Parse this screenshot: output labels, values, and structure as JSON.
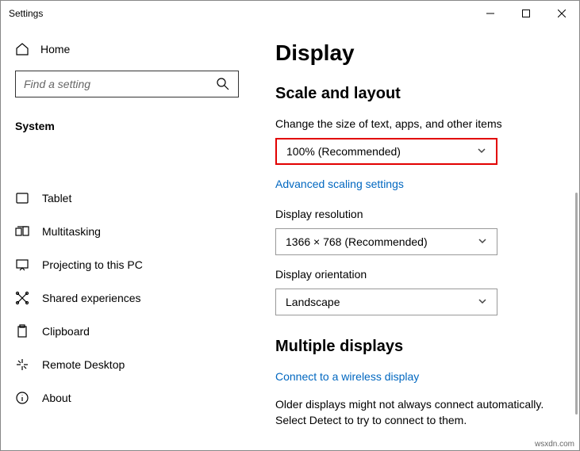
{
  "window": {
    "title": "Settings"
  },
  "sidebar": {
    "home_label": "Home",
    "search_placeholder": "Find a setting",
    "category_label": "System",
    "items": [
      {
        "label": "Tablet"
      },
      {
        "label": "Multitasking"
      },
      {
        "label": "Projecting to this PC"
      },
      {
        "label": "Shared experiences"
      },
      {
        "label": "Clipboard"
      },
      {
        "label": "Remote Desktop"
      },
      {
        "label": "About"
      }
    ]
  },
  "main": {
    "page_title": "Display",
    "section1_title": "Scale and layout",
    "scale_label": "Change the size of text, apps, and other items",
    "scale_value": "100% (Recommended)",
    "advanced_link": "Advanced scaling settings",
    "resolution_label": "Display resolution",
    "resolution_value": "1366 × 768 (Recommended)",
    "orientation_label": "Display orientation",
    "orientation_value": "Landscape",
    "section2_title": "Multiple displays",
    "wireless_link": "Connect to a wireless display",
    "note_text": "Older displays might not always connect automatically. Select Detect to try to connect to them."
  },
  "watermark": "wsxdn.com"
}
